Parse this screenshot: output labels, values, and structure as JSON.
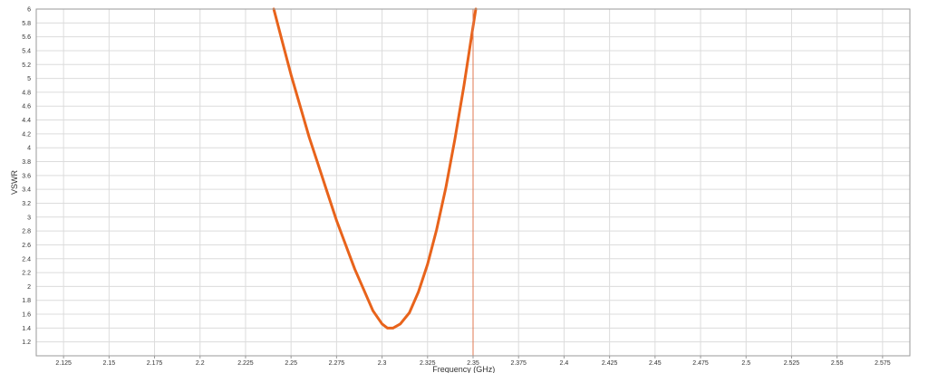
{
  "chart_data": {
    "type": "line",
    "xlabel": "Frequency (GHz)",
    "ylabel": "VSWR",
    "xlim": [
      2.11,
      2.59
    ],
    "ylim": [
      1.0,
      6.0
    ],
    "grid": true,
    "x_ticks": [
      "2.125",
      "2.15",
      "2.175",
      "2.2",
      "2.225",
      "2.25",
      "2.275",
      "2.3",
      "2.325",
      "2.35",
      "2.375",
      "2.4",
      "2.425",
      "2.45",
      "2.475",
      "2.5",
      "2.525",
      "2.55",
      "2.575"
    ],
    "y_ticks": [
      "1.2",
      "1.4",
      "1.6",
      "1.8",
      "2",
      "2.2",
      "2.4",
      "2.6",
      "2.8",
      "3",
      "3.2",
      "3.4",
      "3.6",
      "3.8",
      "4",
      "4.2",
      "4.4",
      "4.6",
      "4.8",
      "5",
      "5.2",
      "5.4",
      "5.6",
      "5.8",
      "6"
    ],
    "series": [
      {
        "color": "#e8631b",
        "x": [
          2.2405,
          2.245,
          2.25,
          2.255,
          2.26,
          2.265,
          2.27,
          2.275,
          2.28,
          2.285,
          2.29,
          2.295,
          2.3,
          2.303,
          2.306,
          2.31,
          2.315,
          2.32,
          2.325,
          2.33,
          2.335,
          2.34,
          2.345,
          2.35,
          2.3515
        ],
        "values": [
          6.0,
          5.55,
          5.05,
          4.6,
          4.15,
          3.75,
          3.35,
          2.95,
          2.6,
          2.25,
          1.95,
          1.65,
          1.46,
          1.4,
          1.4,
          1.46,
          1.62,
          1.92,
          2.32,
          2.82,
          3.42,
          4.12,
          4.9,
          5.75,
          6.0
        ]
      }
    ],
    "markers": [
      {
        "x": 2.35,
        "color": "#e07a52"
      }
    ]
  }
}
